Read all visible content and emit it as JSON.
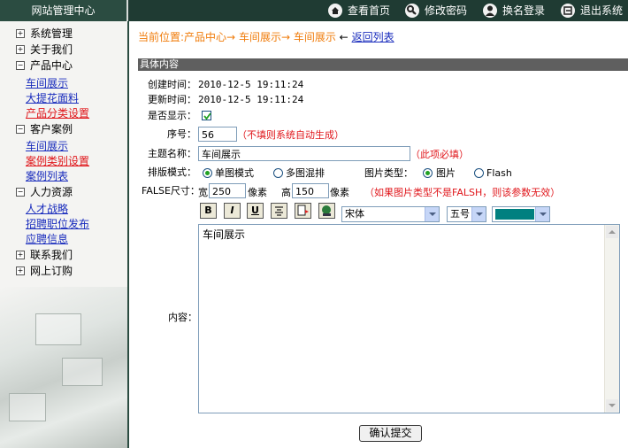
{
  "header": {
    "site_title": "网站管理中心",
    "nav": [
      {
        "label": "查看首页",
        "icon": "home-icon"
      },
      {
        "label": "修改密码",
        "icon": "key-icon"
      },
      {
        "label": "换名登录",
        "icon": "user-icon"
      },
      {
        "label": "退出系统",
        "icon": "exit-icon"
      }
    ]
  },
  "sidebar": {
    "groups": [
      {
        "label": "系统管理",
        "expander": "+",
        "items": []
      },
      {
        "label": "关于我们",
        "expander": "+",
        "items": []
      },
      {
        "label": "产品中心",
        "expander": "−",
        "items": [
          {
            "label": "车间展示",
            "color": "#1a2dbd"
          },
          {
            "label": "大提花面料",
            "color": "#1a2dbd"
          },
          {
            "label": "产品分类设置",
            "color": "#e0161b"
          }
        ]
      },
      {
        "label": "客户案例",
        "expander": "−",
        "items": [
          {
            "label": "车间展示",
            "color": "#1a2dbd"
          },
          {
            "label": "案例类别设置",
            "color": "#e0161b"
          },
          {
            "label": "案例列表",
            "color": "#1a2dbd"
          }
        ]
      },
      {
        "label": "人力资源",
        "expander": "−",
        "items": [
          {
            "label": "人才战略",
            "color": "#1a2dbd"
          },
          {
            "label": "招聘职位发布",
            "color": "#1a2dbd"
          },
          {
            "label": "应聘信息",
            "color": "#1a2dbd"
          }
        ]
      },
      {
        "label": "联系我们",
        "expander": "+",
        "items": []
      },
      {
        "label": "网上订购",
        "expander": "+",
        "items": []
      }
    ]
  },
  "breadcrumb": {
    "prefix": "当前位置:产品中心→",
    "level2": "车间展示→",
    "level3": "车间展示",
    "arrow": "←",
    "back": "返回列表"
  },
  "section_title": "具体内容",
  "form": {
    "created_label": "创建时间：",
    "created_value": "2010-12-5 19:11:24",
    "updated_label": "更新时间：",
    "updated_value": "2010-12-5 19:11:24",
    "show_label": "是否显示：",
    "show_checked": true,
    "seq_label": "序号：",
    "seq_value": "56",
    "seq_note": "（不填则系统自动生成）",
    "title_label": "主题名称：",
    "title_value": "车间展示",
    "title_note": "（此项必填）",
    "layout_label": "排版模式：",
    "layout_options": [
      "单图模式",
      "多图混排"
    ],
    "layout_selected": "单图模式",
    "pictype_label": "图片类型：",
    "pictype_options": [
      "图片",
      "Flash"
    ],
    "pictype_selected": "图片",
    "size_label": "FALSE尺寸：",
    "width_label": "宽",
    "width_value": "250",
    "width_unit": "像素",
    "height_label": "高",
    "height_value": "150",
    "height_unit": "像素",
    "size_note": "（如果图片类型不是FALSH，则该参数无效）",
    "content_label": "内容：",
    "content_value": "车间展示"
  },
  "editor": {
    "buttons": [
      "B",
      "I",
      "U"
    ],
    "font_value": "宋体",
    "size_value": "五号",
    "color_value": "#008080"
  },
  "submit_label": "确认提交"
}
